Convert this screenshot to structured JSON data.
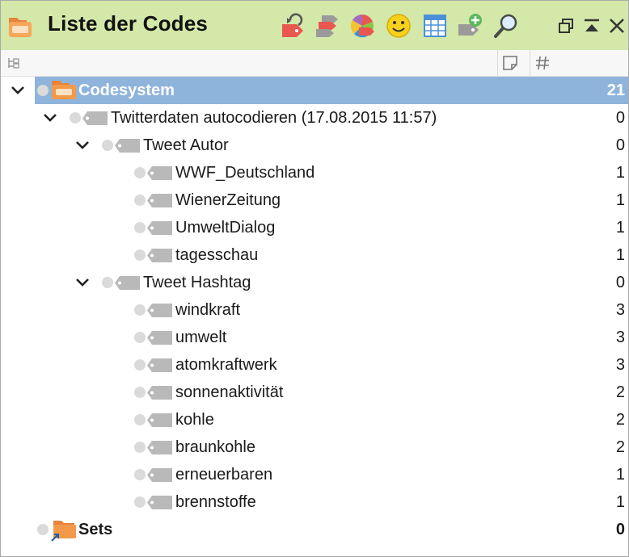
{
  "window": {
    "title": "Liste der Codes"
  },
  "toolbar": [
    {
      "icon": "undo-tag-icon"
    },
    {
      "icon": "code-tags-icon"
    },
    {
      "icon": "color-palette-icon"
    },
    {
      "icon": "emoticon-icon"
    },
    {
      "icon": "table-grid-icon"
    },
    {
      "icon": "add-code-icon"
    },
    {
      "icon": "search-icon"
    }
  ],
  "window_controls": [
    {
      "icon": "undock-icon"
    },
    {
      "icon": "collapse-icon"
    },
    {
      "icon": "close-icon"
    }
  ],
  "columns": {
    "tree_icon": "hierarchy-icon",
    "memo_icon": "memo-icon",
    "count_icon": "hash-icon"
  },
  "tree": [
    {
      "label": "Codesystem",
      "count": "21",
      "level": 0,
      "expanded": true,
      "type": "root",
      "selected": true
    },
    {
      "label": "Twitterdaten autocodieren (17.08.2015 11:57)",
      "count": "0",
      "level": 1,
      "expanded": true,
      "type": "code"
    },
    {
      "label": "Tweet Autor",
      "count": "0",
      "level": 2,
      "expanded": true,
      "type": "code"
    },
    {
      "label": "WWF_Deutschland",
      "count": "1",
      "level": 3,
      "type": "code"
    },
    {
      "label": "WienerZeitung",
      "count": "1",
      "level": 3,
      "type": "code"
    },
    {
      "label": "UmweltDialog",
      "count": "1",
      "level": 3,
      "type": "code"
    },
    {
      "label": "tagesschau",
      "count": "1",
      "level": 3,
      "type": "code"
    },
    {
      "label": "Tweet Hashtag",
      "count": "0",
      "level": 2,
      "expanded": true,
      "type": "code"
    },
    {
      "label": "windkraft",
      "count": "3",
      "level": 3,
      "type": "code"
    },
    {
      "label": "umwelt",
      "count": "3",
      "level": 3,
      "type": "code"
    },
    {
      "label": "atomkraftwerk",
      "count": "3",
      "level": 3,
      "type": "code"
    },
    {
      "label": "sonnenaktivität",
      "count": "2",
      "level": 3,
      "type": "code"
    },
    {
      "label": "kohle",
      "count": "2",
      "level": 3,
      "type": "code"
    },
    {
      "label": "braunkohle",
      "count": "2",
      "level": 3,
      "type": "code"
    },
    {
      "label": "erneuerbaren",
      "count": "1",
      "level": 3,
      "type": "code"
    },
    {
      "label": "brennstoffe",
      "count": "1",
      "level": 3,
      "type": "code"
    },
    {
      "label": "Sets",
      "count": "0",
      "level": 0,
      "type": "sets"
    }
  ],
  "colors": {
    "titlebar": "#d3e8a9",
    "selection": "#8fb4dc",
    "code_tag": "#b9b9b9",
    "folder": "#f39a4a"
  }
}
